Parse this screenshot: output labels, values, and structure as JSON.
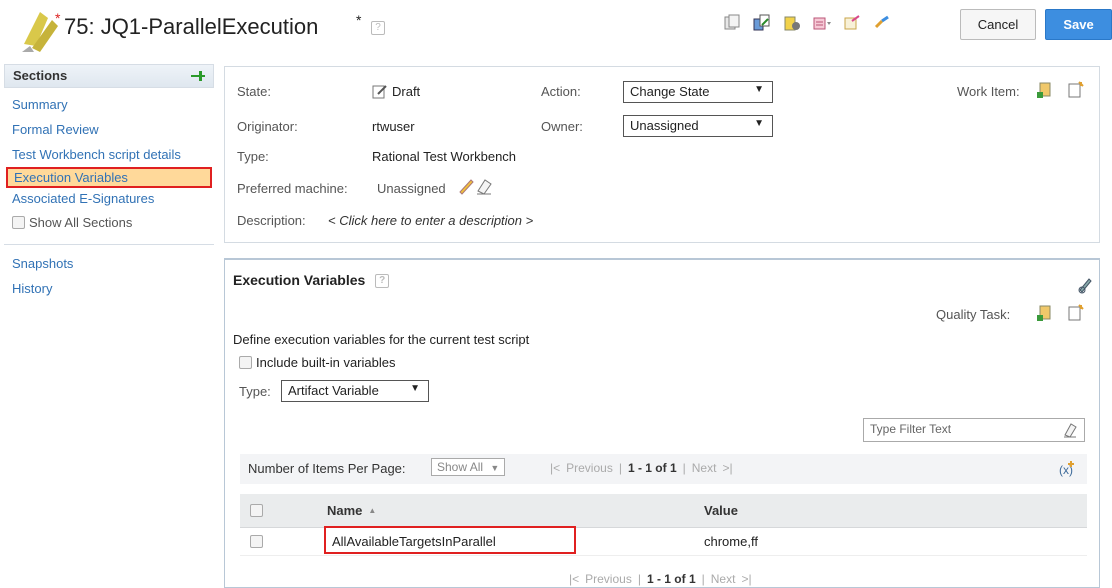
{
  "header": {
    "dirty_marker": "*",
    "title": "75: JQ1-ParallelExecution",
    "title_dirty_marker": "*",
    "help_label": "?",
    "toolbar_icons": [
      "copy-icon",
      "duplicate-icon",
      "lock-edit-icon",
      "view-menu-icon",
      "export-icon",
      "link-icon"
    ],
    "cancel_label": "Cancel",
    "save_label": "Save"
  },
  "sidebar": {
    "heading": "Sections",
    "items": [
      {
        "label": "Summary"
      },
      {
        "label": "Formal Review"
      },
      {
        "label": "Test Workbench script details"
      },
      {
        "label": "Execution Variables",
        "active": true
      },
      {
        "label": "Associated E-Signatures"
      }
    ],
    "show_all_label": "Show All Sections",
    "extra_items": [
      {
        "label": "Snapshots"
      },
      {
        "label": "History"
      }
    ]
  },
  "details": {
    "state_label": "State:",
    "state_value": "Draft",
    "action_label": "Action:",
    "action_value": "Change State",
    "work_item_label": "Work Item:",
    "originator_label": "Originator:",
    "originator_value": "rtwuser",
    "owner_label": "Owner:",
    "owner_value": "Unassigned",
    "type_label": "Type:",
    "type_value": "Rational Test Workbench",
    "machine_label": "Preferred machine:",
    "machine_value": "Unassigned",
    "description_label": "Description:",
    "description_placeholder": "< Click here to enter a description >"
  },
  "execution_variables": {
    "title": "Execution Variables",
    "quality_task_label": "Quality Task:",
    "intro": "Define execution variables for the current test script",
    "include_builtin_label": "Include built-in variables",
    "type_label": "Type:",
    "type_value": "Artifact Variable",
    "filter_placeholder": "Type Filter Text",
    "per_page_label": "Number of Items Per Page:",
    "per_page_value": "Show All",
    "pager": {
      "first_glyph": "|<",
      "previous": "Previous",
      "separator": "|",
      "range": "1 - 1 of 1",
      "next": "Next",
      "last_glyph": ">|"
    },
    "columns": {
      "name": "Name",
      "value": "Value"
    },
    "sort_glyph": "▲",
    "rows": [
      {
        "name": "AllAvailableTargetsInParallel",
        "value": "chrome,ff"
      }
    ]
  },
  "colors": {
    "accent": "#3d8ee0",
    "link": "#3172b5",
    "active_section": "#ffd99a",
    "highlight_box": "#e02020"
  }
}
